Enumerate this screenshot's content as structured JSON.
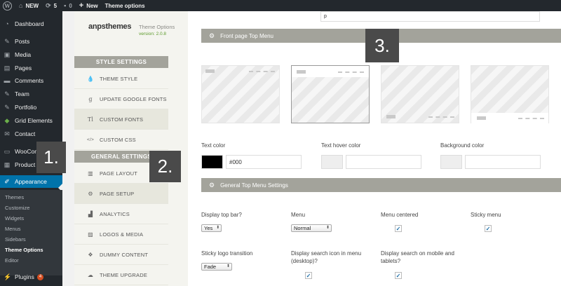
{
  "admin_bar": {
    "site_name": "NEW",
    "updates_count": "5",
    "comments_count": "0",
    "new_label": "New",
    "theme_options_label": "Theme options"
  },
  "sidebar": {
    "items": [
      {
        "label": "Dashboard",
        "icon": "dashboard-icon"
      },
      {
        "label": "Posts",
        "icon": "pin-icon"
      },
      {
        "label": "Media",
        "icon": "media-icon"
      },
      {
        "label": "Pages",
        "icon": "pages-icon"
      },
      {
        "label": "Comments",
        "icon": "comments-icon"
      },
      {
        "label": "Team",
        "icon": "pin-icon"
      },
      {
        "label": "Portfolio",
        "icon": "pin-icon"
      },
      {
        "label": "Grid Elements",
        "icon": "grid-icon"
      },
      {
        "label": "Contact",
        "icon": "mail-icon"
      },
      {
        "label": "WooCom",
        "icon": "woo-icon"
      },
      {
        "label": "Product",
        "icon": "product-icon"
      },
      {
        "label": "Appearance",
        "icon": "brush-icon"
      }
    ],
    "submenu": [
      "Themes",
      "Customize",
      "Widgets",
      "Menus",
      "Sidebars",
      "Theme Options",
      "Editor"
    ],
    "plugins_label": "Plugins",
    "plugins_badge": "4"
  },
  "steps": [
    "1.",
    "2.",
    "3."
  ],
  "options_panel": {
    "brand": "anpsthemes",
    "title": "Theme Options",
    "version": "version: 2.0.8",
    "style_settings": "STYLE SETTINGS",
    "style_items": [
      "THEME STYLE",
      "UPDATE GOOGLE FONTS",
      "CUSTOM FONTS",
      "CUSTOM CSS"
    ],
    "general_settings": "GENERAL SETTINGS",
    "general_items": [
      "PAGE LAYOUT",
      "PAGE SETUP",
      "ANALYTICS",
      "LOGOS & MEDIA",
      "DUMMY CONTENT",
      "THEME UPGRADE"
    ]
  },
  "main": {
    "top_input_value": "p",
    "front_page_menu_title": "Front page Top Menu",
    "text_color_label": "Text color",
    "text_color_value": "#000",
    "text_hover_color_label": "Text hover color",
    "background_color_label": "Background color",
    "general_top_menu_title": "General Top Menu Settings",
    "fields": {
      "display_top_bar": {
        "label": "Display top bar?",
        "value": "Yes"
      },
      "menu": {
        "label": "Menu",
        "value": "Normal"
      },
      "menu_centered": {
        "label": "Menu centered"
      },
      "sticky_menu": {
        "label": "Sticky menu"
      },
      "sticky_logo": {
        "label": "Sticky logo transition",
        "value": "Fade"
      },
      "search_icon": {
        "label_line1": "Display search icon in menu",
        "label_line2": "(desktop)?"
      },
      "search_mobile": {
        "label_line1": "Display search on mobile and",
        "label_line2": "tablets?"
      }
    }
  },
  "colors": {
    "admin_bg": "#23282d",
    "accent": "#0073aa",
    "section_bar": "#a3a39b",
    "version_green": "#5c9a2c"
  }
}
